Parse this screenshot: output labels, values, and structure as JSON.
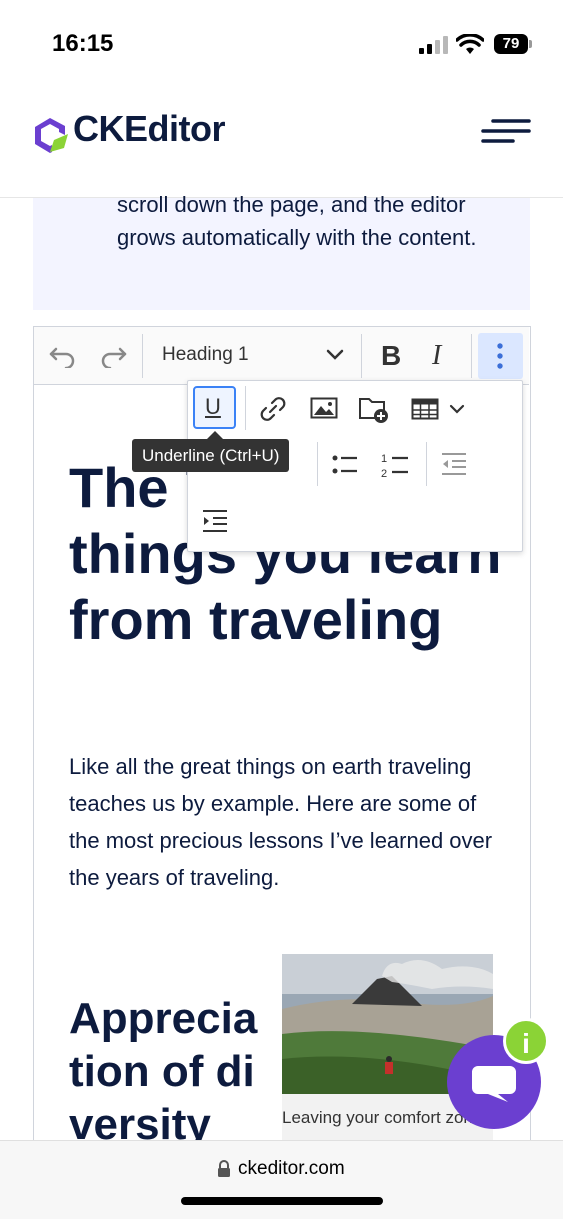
{
  "status_bar": {
    "time": "16:15",
    "battery": "79"
  },
  "header": {
    "logo_text": "CKEditor",
    "menu_icon": "hamburger-icon"
  },
  "intro": {
    "text": "scroll down the page, and the editor grows automatically with the content."
  },
  "toolbar": {
    "heading_select": "Heading 1",
    "bold_label": "B",
    "italic_label": "I",
    "icons": [
      "undo-icon",
      "redo-icon",
      "chevron-down-icon",
      "more-vertical-icon"
    ]
  },
  "dropdown": {
    "underline_label": "U",
    "tooltip": "Underline (Ctrl+U)",
    "icons": [
      "underline-icon",
      "link-icon",
      "image-icon",
      "insert-media-icon",
      "table-icon",
      "bulleted-list-icon",
      "numbered-list-icon",
      "outdent-icon",
      "indent-icon"
    ]
  },
  "article": {
    "heading": "The 7 greatest things you learn from traveling",
    "paragraph": "Like all the great things on earth traveling teaches us by example. Here are some of the most precious lessons I’ve learned over the years of traveling.",
    "subheading": "Appreciation of diversity",
    "image_caption": "Leaving your comfort zone might lead you to such beautiful sceneries like this one."
  },
  "chat_widget": {
    "badge": "i"
  },
  "url_bar": {
    "url": "ckeditor.com"
  },
  "colors": {
    "brand_purple": "#6b3fd0",
    "brand_green": "#8bd336",
    "text_navy": "#0d1b3e",
    "active_blue": "#3b82f6"
  }
}
